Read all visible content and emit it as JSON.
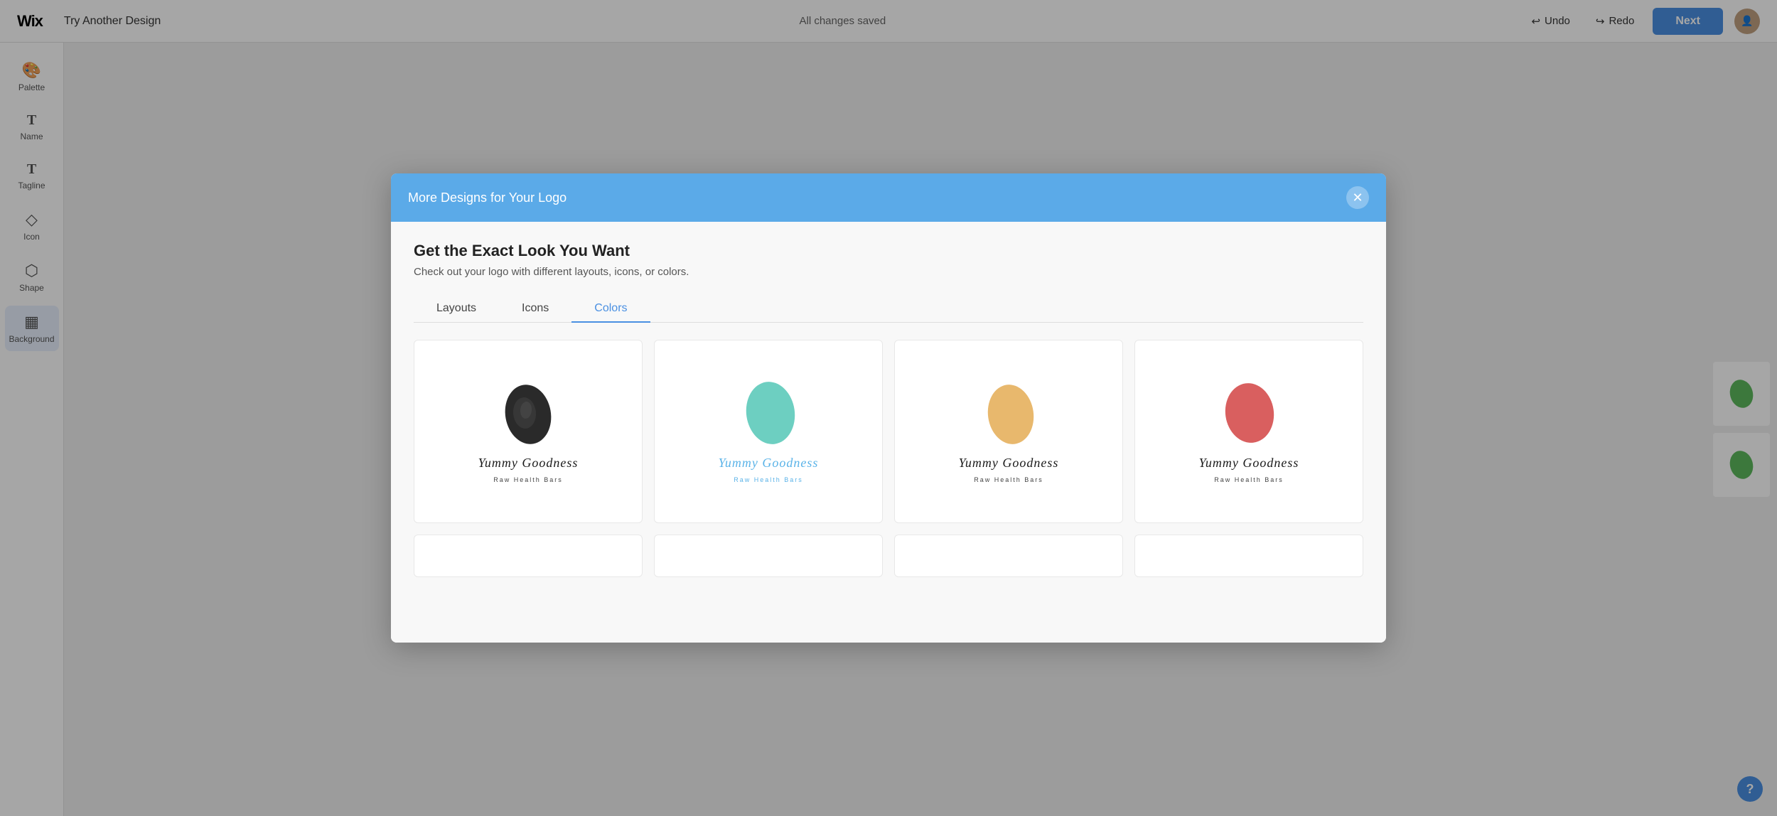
{
  "topbar": {
    "wix_logo": "Wix",
    "try_another_design": "Try Another Design",
    "all_changes_saved": "All changes saved",
    "undo_label": "Undo",
    "redo_label": "Redo",
    "next_label": "Next"
  },
  "sidebar": {
    "items": [
      {
        "id": "palette",
        "label": "Palette",
        "icon": "🎨"
      },
      {
        "id": "name",
        "label": "Name",
        "icon": "T"
      },
      {
        "id": "tagline",
        "label": "Tagline",
        "icon": "T"
      },
      {
        "id": "icon",
        "label": "Icon",
        "icon": "◇"
      },
      {
        "id": "shape",
        "label": "Shape",
        "icon": "⬡"
      },
      {
        "id": "background",
        "label": "Background",
        "icon": "▦"
      }
    ]
  },
  "modal": {
    "title": "More Designs for Your Logo",
    "heading": "Get the Exact Look You Want",
    "subheading": "Check out your logo with different layouts, icons, or colors.",
    "tabs": [
      {
        "id": "layouts",
        "label": "Layouts"
      },
      {
        "id": "icons",
        "label": "Icons"
      },
      {
        "id": "colors",
        "label": "Colors",
        "active": true
      }
    ],
    "logo_cards": [
      {
        "id": "card1",
        "shape_color": "#2a2a2a",
        "text_color": "#1a1a1a",
        "text_main": "Yummy Goodness",
        "text_sub": "Raw Health Bars",
        "shape_style": "dark"
      },
      {
        "id": "card2",
        "shape_color": "#6dcfc1",
        "text_color": "#5ab3e8",
        "text_main": "Yummy Goodness",
        "text_sub": "Raw Health Bars",
        "shape_style": "teal"
      },
      {
        "id": "card3",
        "shape_color": "#e8b86d",
        "text_color": "#2a2a2a",
        "text_main": "Yummy Goodness",
        "text_sub": "Raw Health Bars",
        "shape_style": "yellow"
      },
      {
        "id": "card4",
        "shape_color": "#d95f5f",
        "text_color": "#2a2a2a",
        "text_main": "Yummy Goodness",
        "text_sub": "Raw Health Bars",
        "shape_style": "red"
      }
    ],
    "bottom_row": [
      {
        "id": "card5"
      },
      {
        "id": "card6"
      },
      {
        "id": "card7"
      },
      {
        "id": "card8"
      }
    ]
  },
  "help": {
    "label": "?"
  }
}
